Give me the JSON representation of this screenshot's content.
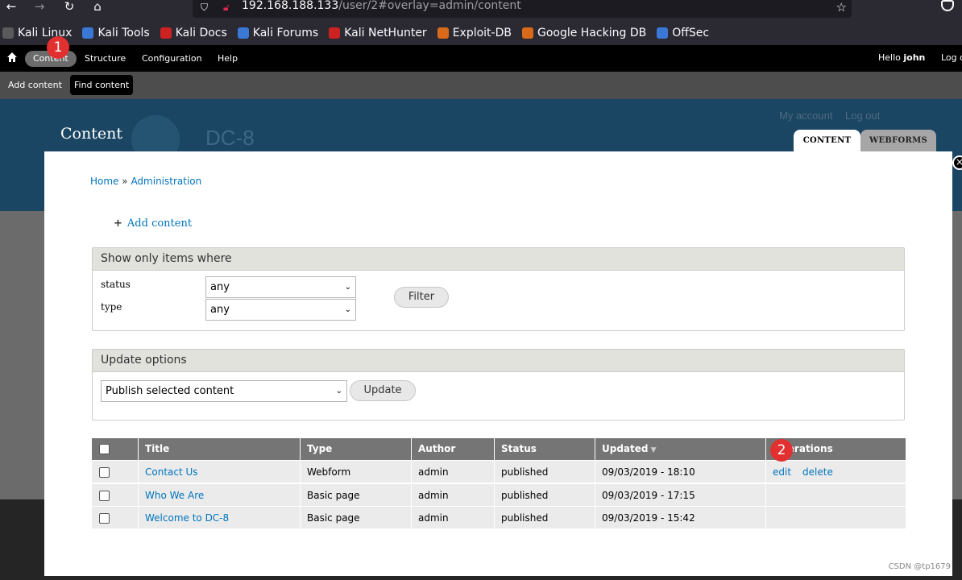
{
  "browser": {
    "url_host": "192.168.188.133",
    "url_path": "/user/2#overlay=admin/content",
    "bookmarks": [
      {
        "label": "Kali Linux",
        "color": "#5a5a5a"
      },
      {
        "label": "Kali Tools",
        "color": "#3a78d6"
      },
      {
        "label": "Kali Docs",
        "color": "#cc2222"
      },
      {
        "label": "Kali Forums",
        "color": "#3a78d6"
      },
      {
        "label": "Kali NetHunter",
        "color": "#cc2222"
      },
      {
        "label": "Exploit-DB",
        "color": "#d86a1a"
      },
      {
        "label": "Google Hacking DB",
        "color": "#d86a1a"
      },
      {
        "label": "OffSec",
        "color": "#3a78d6"
      }
    ]
  },
  "toolbar": {
    "items": [
      "Content",
      "Structure",
      "Configuration",
      "Help"
    ],
    "hello": "Hello",
    "user": "john",
    "logout": "Log out"
  },
  "shortcuts": {
    "add_content": "Add content",
    "find_content": "Find content"
  },
  "site": {
    "overlay_title": "Content",
    "name": "DC-8",
    "my_account": "My account",
    "log_out": "Log out",
    "tabs": [
      "CONTENT",
      "WEBFORMS"
    ]
  },
  "breadcrumb": {
    "home": "Home",
    "sep": "»",
    "admin": "Administration"
  },
  "actions": {
    "add_content": "Add content"
  },
  "filter": {
    "legend": "Show only items where",
    "status_label": "status",
    "status_value": "any",
    "type_label": "type",
    "type_value": "any",
    "button": "Filter"
  },
  "update": {
    "legend": "Update options",
    "select_value": "Publish selected content",
    "button": "Update"
  },
  "table": {
    "headers": [
      "Title",
      "Type",
      "Author",
      "Status",
      "Updated",
      "Operations"
    ],
    "rows": [
      {
        "title": "Contact Us",
        "type": "Webform",
        "author": "admin",
        "status": "published",
        "updated": "09/03/2019 - 18:10",
        "edit": "edit",
        "delete": "delete"
      },
      {
        "title": "Who We Are",
        "type": "Basic page",
        "author": "admin",
        "status": "published",
        "updated": "09/03/2019 - 17:15",
        "edit": "",
        "delete": ""
      },
      {
        "title": "Welcome to DC-8",
        "type": "Basic page",
        "author": "admin",
        "status": "published",
        "updated": "09/03/2019 - 15:42",
        "edit": "",
        "delete": ""
      }
    ]
  },
  "annotations": [
    "1",
    "2"
  ],
  "watermark": "CSDN @tp1679"
}
